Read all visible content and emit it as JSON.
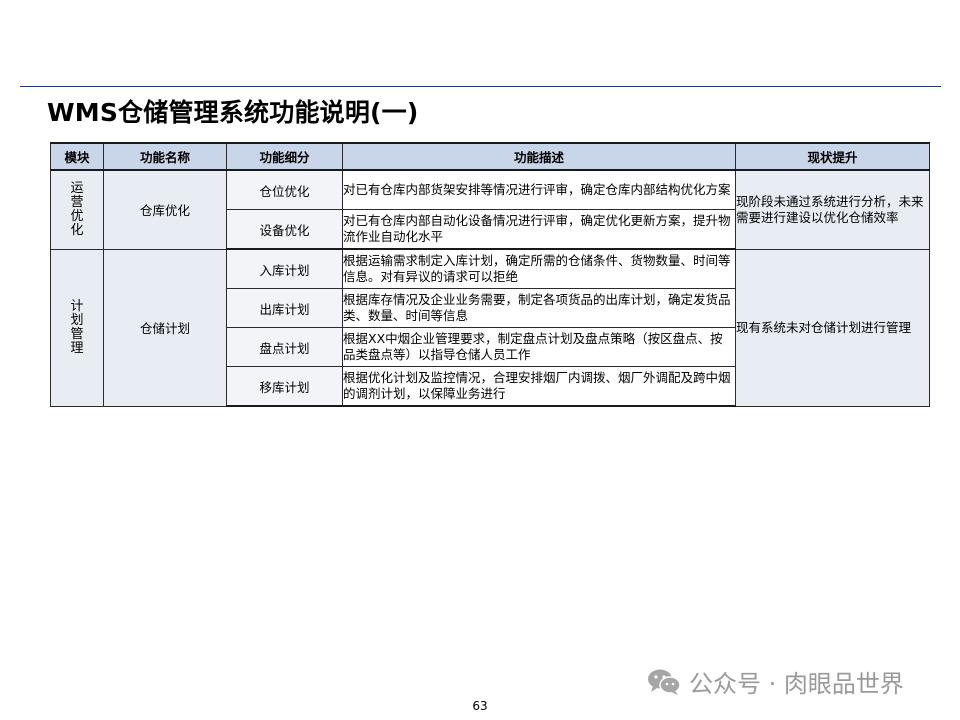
{
  "title": "WMS仓储管理系统功能说明(一)",
  "table": {
    "headers": [
      "模块",
      "功能名称",
      "功能细分",
      "功能描述",
      "现状提升"
    ],
    "groups": [
      {
        "module": "运营优化",
        "function_name": "仓库优化",
        "status": "现阶段未通过系统进行分析，未来需要进行建设以优化仓储效率",
        "rows": [
          {
            "sub": "仓位优化",
            "desc": "对已有仓库内部货架安排等情况进行评审，确定仓库内部结构优化方案"
          },
          {
            "sub": "设备优化",
            "desc": "对已有仓库内部自动化设备情况进行评审，确定优化更新方案，提升物流作业自动化水平"
          }
        ]
      },
      {
        "module": "计划管理",
        "function_name": "仓储计划",
        "status": "现有系统未对仓储计划进行管理",
        "rows": [
          {
            "sub": "入库计划",
            "desc": "根据运输需求制定入库计划，确定所需的仓储条件、货物数量、时间等信息。对有异议的请求可以拒绝"
          },
          {
            "sub": "出库计划",
            "desc": "根据库存情况及企业业务需要，制定各项货品的出库计划，确定发货品类、数量、时间等信息"
          },
          {
            "sub": "盘点计划",
            "desc": "根据XX中烟企业管理要求，制定盘点计划及盘点策略（按区盘点、按品类盘点等）以指导仓储人员工作"
          },
          {
            "sub": "移库计划",
            "desc": "根据优化计划及监控情况，合理安排烟厂内调拨、烟厂外调配及跨中烟的调剂计划，以保障业务进行"
          }
        ]
      }
    ]
  },
  "watermark": "公众号 · 肉眼品世界",
  "page_number": "63"
}
